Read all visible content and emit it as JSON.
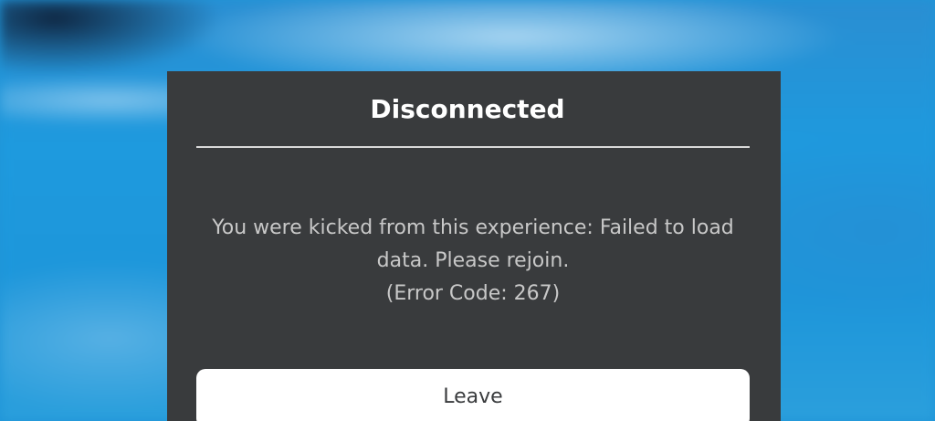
{
  "dialog": {
    "title": "Disconnected",
    "message_line_1": "You were kicked from this experience: Failed to load",
    "message_line_2": "data. Please rejoin.",
    "error_code": "(Error Code: 267)",
    "leave_label": "Leave"
  },
  "colors": {
    "dialog_background": "#393b3d",
    "title_text": "#ffffff",
    "message_text": "#c8c8c8",
    "button_background": "#ffffff",
    "backdrop": "#1f95d8"
  }
}
